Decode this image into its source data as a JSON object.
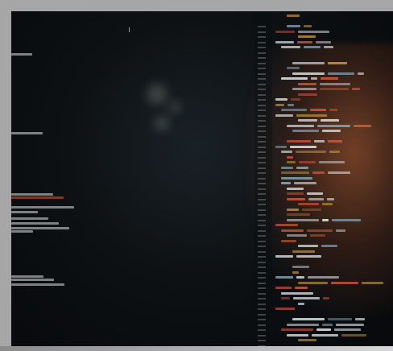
{
  "scene": {
    "subject": "",
    "colors": {
      "frame": "#a6a6a6",
      "screen": "#0d1114",
      "keyword": "#d9593a",
      "string": "#d4a23e",
      "identifier": "#e6ecef",
      "accent": "#8bb0c2"
    }
  }
}
